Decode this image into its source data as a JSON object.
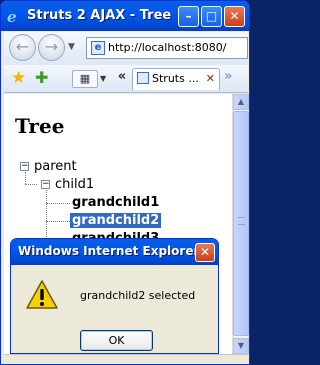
{
  "window": {
    "title": "Struts 2 AJAX - Tree",
    "min_glyph": "–",
    "max_glyph": "□",
    "close_glyph": "✕"
  },
  "navbar": {
    "back_glyph": "←",
    "forward_glyph": "→",
    "dropdown_glyph": "▼",
    "address": "http://localhost:8080/"
  },
  "tabbar": {
    "quick_tabs_glyph": "▦",
    "dropdown_glyph": "▼",
    "scroll_left_glyph": "«",
    "scroll_right_glyph": "»",
    "tab_label": "Struts ...",
    "tab_close_glyph": "✕"
  },
  "page": {
    "heading": "Tree"
  },
  "tree": {
    "parent": "parent",
    "child1": "child1",
    "grandchild1": "grandchild1",
    "grandchild2": "grandchild2",
    "grandchild3": "grandchild3",
    "collapse_glyph": "−"
  },
  "dialog": {
    "title": "Windows Internet Explorer",
    "message": "grandchild2 selected",
    "ok_label": "OK",
    "close_glyph": "✕"
  },
  "scrollbar": {
    "up_glyph": "▲",
    "down_glyph": "▼"
  },
  "colors": {
    "titlebar": "#0058ee",
    "selection": "#316ac5",
    "dialog_bg": "#ece9d8"
  }
}
